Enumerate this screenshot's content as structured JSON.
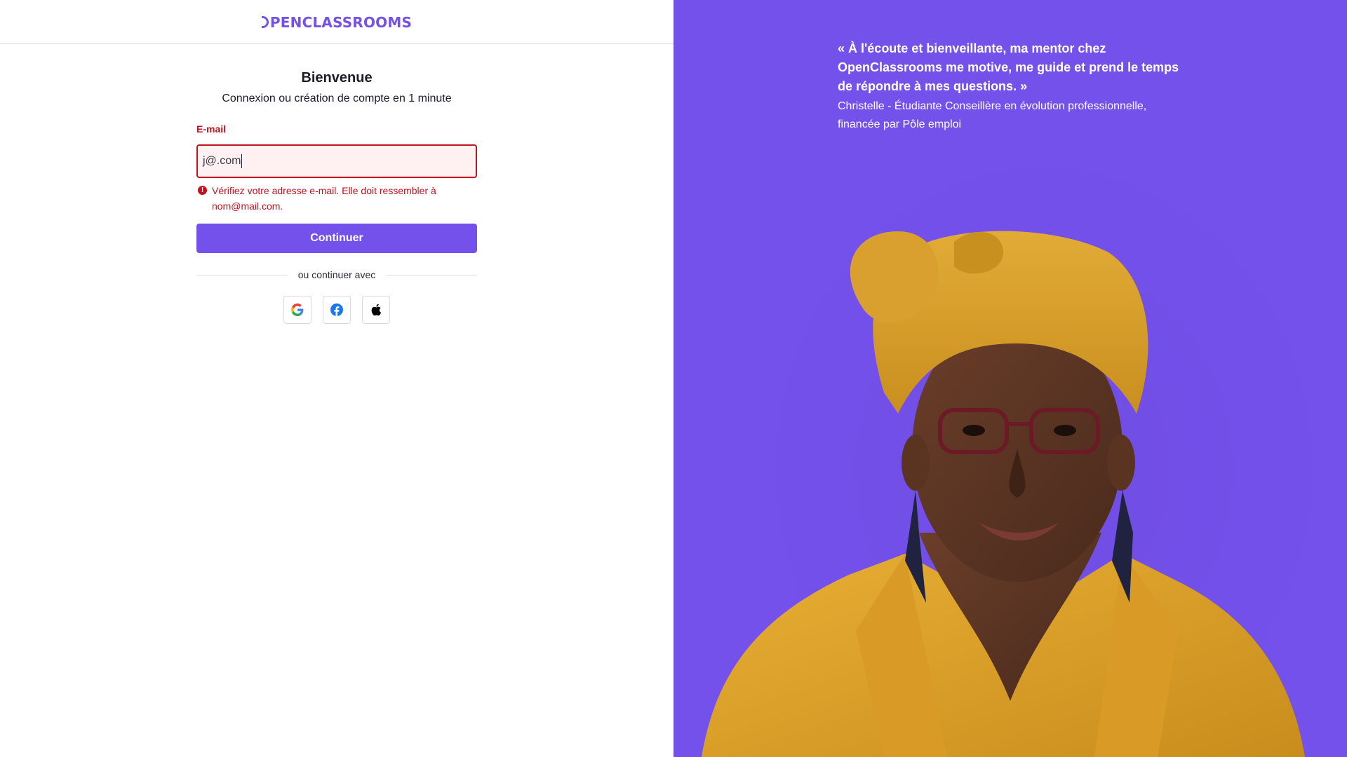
{
  "header": {
    "logo_text": "PENCLASSROOMS",
    "logo_icon": "openclassrooms-logo-icon"
  },
  "form": {
    "title": "Bienvenue",
    "subtitle": "Connexion ou création de compte en 1 minute",
    "email_label": "E-mail",
    "email_value": "j@.com",
    "error_icon": "error-icon",
    "error_message": "Vérifiez votre adresse e-mail. Elle doit ressembler à nom@mail.com.",
    "continue_label": "Continuer",
    "divider_text": "ou continuer avec",
    "social_providers": [
      {
        "name": "google",
        "icon": "google-icon"
      },
      {
        "name": "facebook",
        "icon": "facebook-icon"
      },
      {
        "name": "apple",
        "icon": "apple-icon"
      }
    ]
  },
  "testimonial": {
    "quote": "« À l'écoute et bienveillante, ma mentor chez OpenClassrooms me motive, me guide et prend le temps de répondre à mes questions. »",
    "author": "Christelle - Étudiante Conseillère en évolution professionnelle, financée par Pôle emploi"
  },
  "colors": {
    "brand": "#7451eb",
    "error": "#c1121f",
    "error_bg": "#fff1f1",
    "text": "#1b1b2e",
    "border": "#d9d9dc"
  }
}
